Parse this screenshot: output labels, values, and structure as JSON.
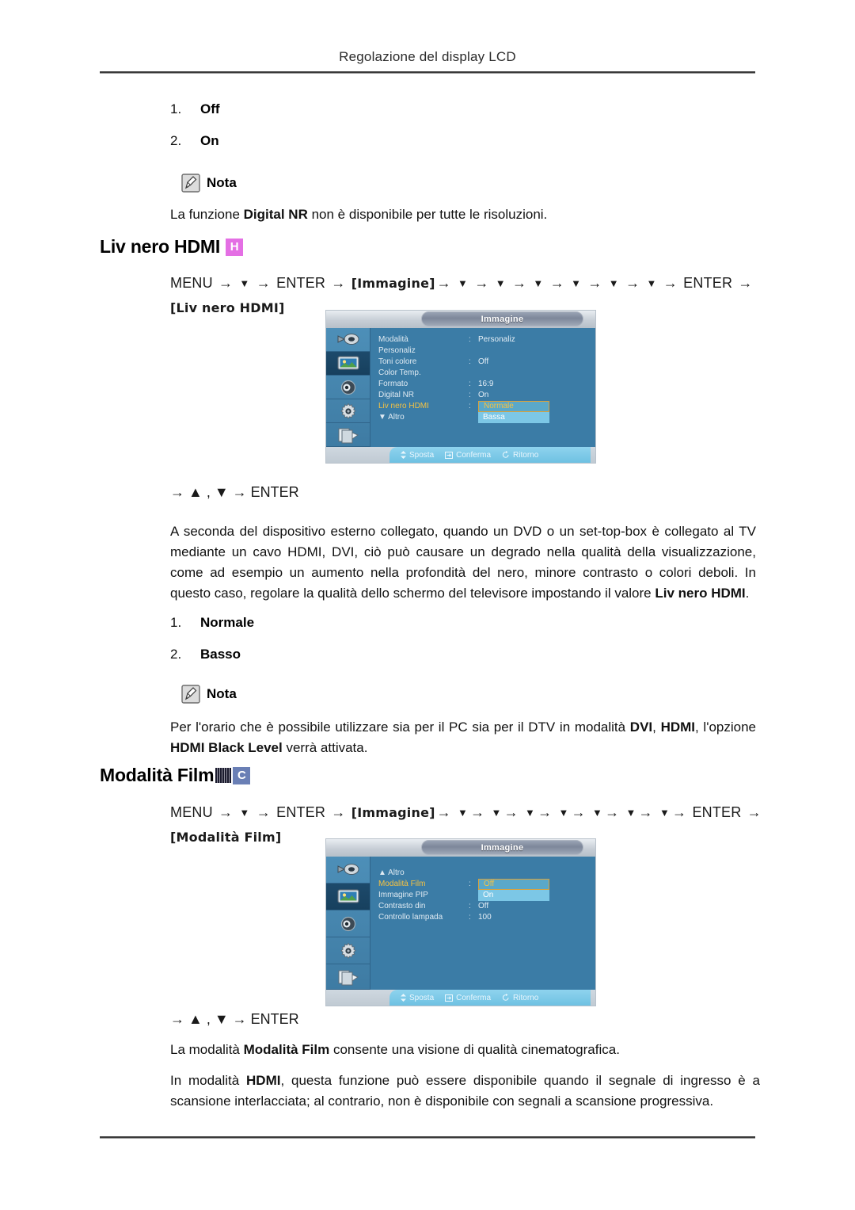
{
  "page": {
    "running_head": "Regolazione del display LCD"
  },
  "top_list": [
    {
      "num": "1.",
      "label": "Off"
    },
    {
      "num": "2.",
      "label": "On"
    }
  ],
  "note1": {
    "icon": "note-pencil-icon",
    "label": "Nota",
    "text_parts": [
      {
        "t": "La funzione ",
        "b": false
      },
      {
        "t": "Digital NR",
        "b": true
      },
      {
        "t": " non è disponibile per tutte le risoluzioni.",
        "b": false
      }
    ]
  },
  "section1": {
    "heading": "Liv nero HDMI",
    "badges": [
      {
        "letter": "H",
        "color": "#e46fe4"
      }
    ],
    "navpath": {
      "menu": "MENU",
      "enter": "ENTER",
      "bracket_menu": "[Immagine]",
      "down_arrows": 6,
      "enter2": "ENTER",
      "target": "[Liv nero HDMI]"
    },
    "keyline": "→ ▲ , ▼ → ENTER",
    "paragraph": "A seconda del dispositivo esterno collegato, quando un DVD o un set-top-box è collegato al TV mediante un cavo HDMI, DVI, ciò può causare un degrado nella qualità della visualizzazione, come ad esempio un aumento nella profondità del nero, minore contrasto o colori deboli. In questo caso, regolare la qualità dello schermo del televisore impostando il valore ",
    "paragraph_bold_tail": "Liv nero HDMI",
    "paragraph_tail": ".",
    "options": [
      {
        "num": "1.",
        "label": "Normale"
      },
      {
        "num": "2.",
        "label": "Basso"
      }
    ],
    "note": {
      "icon": "note-pencil-icon",
      "label": "Nota",
      "text_parts": [
        {
          "t": "Per l'orario che è possibile utilizzare sia per il PC sia per il DTV in modalità ",
          "b": false
        },
        {
          "t": "DVI",
          "b": true
        },
        {
          "t": ", ",
          "b": false
        },
        {
          "t": "HDMI",
          "b": true
        },
        {
          "t": ", l'opzione ",
          "b": false
        },
        {
          "t": "HDMI Black Level",
          "b": true
        },
        {
          "t": " verrà attivata.",
          "b": false
        }
      ]
    }
  },
  "osd1": {
    "title": "Immagine",
    "sidebar_icons": [
      "input-source-icon",
      "picture-icon",
      "sound-speaker-icon",
      "setup-gear-icon",
      "multi-control-icon"
    ],
    "active_icon_index": 1,
    "rows": [
      {
        "label": "Modalità",
        "sep": ":",
        "value": "Personaliz",
        "highlight": false
      },
      {
        "label": "Personaliz",
        "sep": "",
        "value": "",
        "highlight": false
      },
      {
        "label": "Toni colore",
        "sep": ":",
        "value": "Off",
        "highlight": false
      },
      {
        "label": "Color Temp.",
        "sep": "",
        "value": "",
        "highlight": false
      },
      {
        "label": "Formato",
        "sep": ":",
        "value": "16:9",
        "highlight": false
      },
      {
        "label": "Digital NR",
        "sep": ":",
        "value": "On",
        "highlight": false
      },
      {
        "label": "Liv nero HDMI",
        "sep": ":",
        "value": "",
        "highlight": true
      },
      {
        "label": "▼  Altro",
        "sep": "",
        "value": "",
        "highlight": false
      }
    ],
    "dropdown": {
      "selected": "Normale",
      "other": "Bassa"
    },
    "footer": [
      {
        "icon": "move-icon",
        "label": "Sposta"
      },
      {
        "icon": "confirm-enter-icon",
        "label": "Conferma"
      },
      {
        "icon": "return-icon",
        "label": "Ritorno"
      }
    ]
  },
  "section2": {
    "heading": "Modalità Film",
    "badges": [
      {
        "letter": "",
        "color": "#1b1b2e",
        "kind": "strip"
      },
      {
        "letter": "C",
        "color": "#6a7fb5",
        "kind": "letter"
      }
    ],
    "navpath": {
      "menu": "MENU",
      "enter": "ENTER",
      "bracket_menu": "[Immagine]",
      "down_arrows": 7,
      "enter2": "ENTER",
      "target": "[Modalità Film]"
    },
    "keyline": "→ ▲ , ▼ → ENTER",
    "paragraph1_parts": [
      {
        "t": "La modalità ",
        "b": false
      },
      {
        "t": "Modalità Film",
        "b": true
      },
      {
        "t": " consente una visione di qualità cinematografica.",
        "b": false
      }
    ],
    "paragraph2_parts": [
      {
        "t": "In modalità ",
        "b": false
      },
      {
        "t": "HDMI",
        "b": true
      },
      {
        "t": ", questa funzione può essere disponibile quando il segnale di ingresso è a scansione interlacciata; al contrario, non è disponibile con segnali a scansione progressiva.",
        "b": false
      }
    ]
  },
  "osd2": {
    "title": "Immagine",
    "sidebar_icons": [
      "input-source-icon",
      "picture-icon",
      "sound-speaker-icon",
      "setup-gear-icon",
      "multi-control-icon"
    ],
    "active_icon_index": 1,
    "rows": [
      {
        "label": "▲  Altro",
        "sep": "",
        "value": "",
        "highlight": false
      },
      {
        "label": "Modalità Film",
        "sep": ":",
        "value": "",
        "highlight": true
      },
      {
        "label": "Immagine PIP",
        "sep": "",
        "value": "",
        "highlight": false
      },
      {
        "label": "Contrasto din",
        "sep": ":",
        "value": "Off",
        "highlight": false
      },
      {
        "label": "Controllo lampada",
        "sep": ":",
        "value": "100",
        "highlight": false
      }
    ],
    "dropdown": {
      "selected": "Off",
      "other": "On"
    },
    "footer": [
      {
        "icon": "move-icon",
        "label": "Sposta"
      },
      {
        "icon": "confirm-enter-icon",
        "label": "Conferma"
      },
      {
        "icon": "return-icon",
        "label": "Ritorno"
      }
    ]
  },
  "colors": {
    "badge_h": "#e46fe4",
    "badge_c": "#6a7fb5",
    "osd_blue": "#3b7ca6",
    "osd_highlight": "#f5c242",
    "osd_option_bg": "#5fb2d4"
  }
}
